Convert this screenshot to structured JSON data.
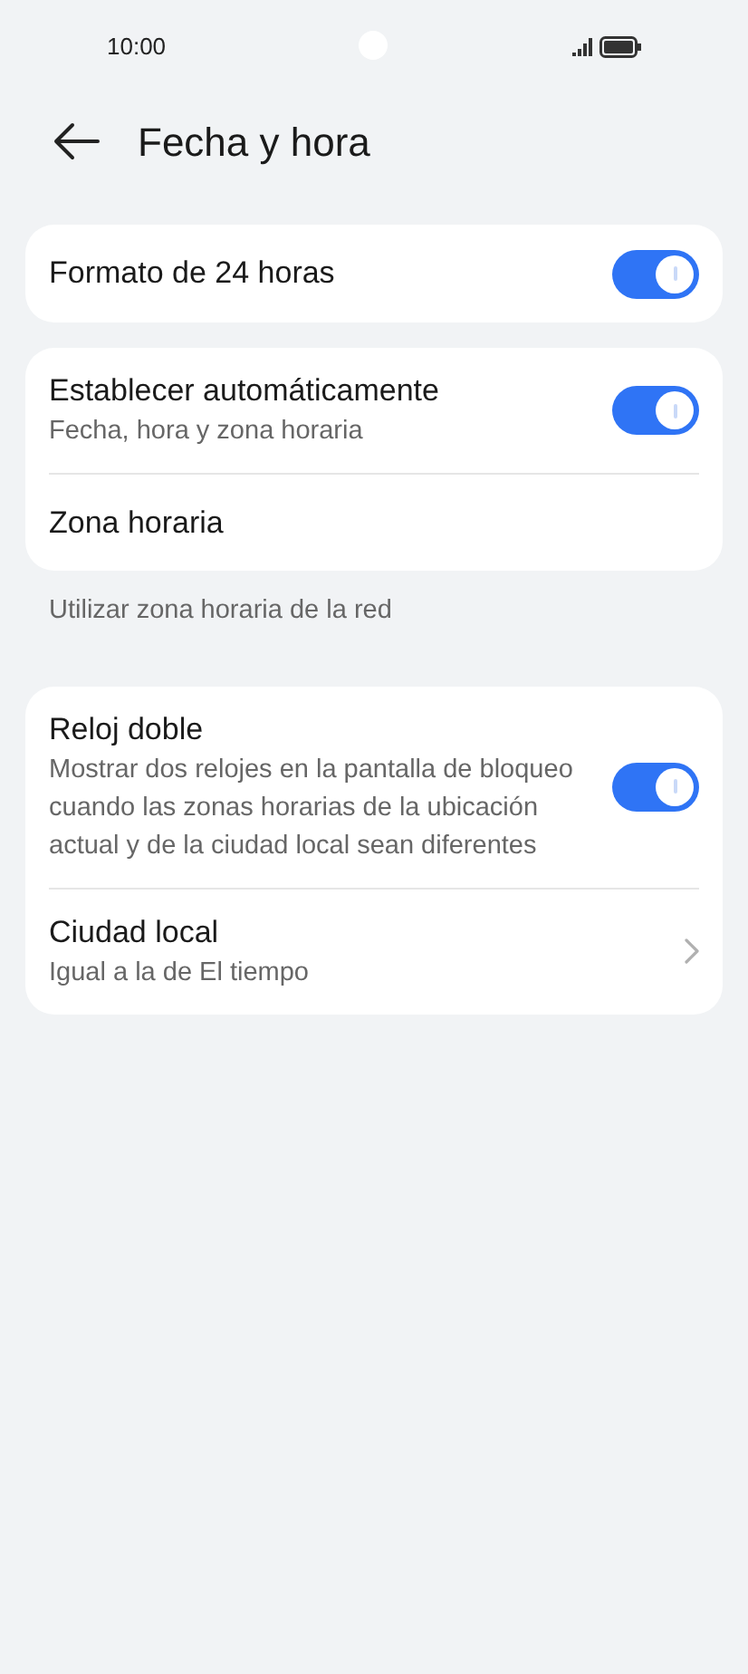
{
  "status_bar": {
    "time": "10:00"
  },
  "header": {
    "title": "Fecha y hora"
  },
  "groups": [
    {
      "rows": [
        {
          "kind": "toggle",
          "title": "Formato de 24 horas",
          "on": true
        }
      ]
    },
    {
      "rows": [
        {
          "kind": "toggle",
          "title": "Establecer automáticamente",
          "subtitle": "Fecha, hora y zona horaria",
          "on": true
        },
        {
          "kind": "plain",
          "title": "Zona horaria"
        }
      ],
      "note": "Utilizar zona horaria de la red"
    },
    {
      "rows": [
        {
          "kind": "toggle",
          "title": "Reloj doble",
          "subtitle": "Mostrar dos relojes en la pantalla de bloqueo cuando las zonas horarias de la ubicación actual y de la ciudad local sean diferentes",
          "on": true
        },
        {
          "kind": "link",
          "title": "Ciudad local",
          "subtitle": "Igual a la de El tiempo"
        }
      ]
    }
  ]
}
